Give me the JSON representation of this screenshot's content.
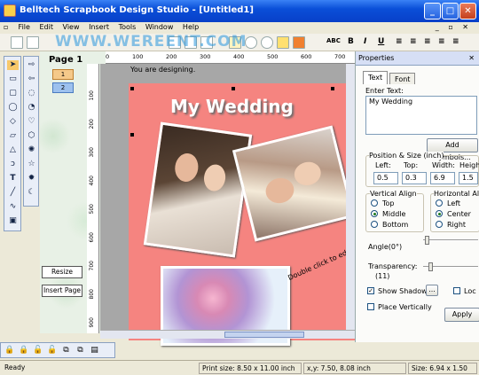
{
  "window": {
    "title": "Belltech Scrapbook Design Studio - [Untitled1]",
    "min": "_",
    "max": "□",
    "close": "✕"
  },
  "menu": {
    "items": [
      "File",
      "Edit",
      "View",
      "Insert",
      "Tools",
      "Window",
      "Help"
    ],
    "mdi_controls": "_ ▫ ✕"
  },
  "toolbar": {
    "watermark": "WWW.WEREENT.COM",
    "bold": "B",
    "italic": "I",
    "underline": "U",
    "abc": "ABC"
  },
  "pages_panel": {
    "label": "Page 1",
    "pages": [
      "1",
      "2"
    ],
    "resize_label": "Resize",
    "insert_page_label": "Insert Page"
  },
  "ruler": {
    "top_ticks": [
      "0",
      "100",
      "200",
      "300",
      "400",
      "500",
      "600",
      "700"
    ],
    "left_ticks": [
      "100",
      "200",
      "300",
      "400",
      "500",
      "600",
      "700",
      "800",
      "900"
    ]
  },
  "canvas": {
    "note": "You are designing.",
    "title_text": "My Wedding",
    "hint": "Double click to edit text"
  },
  "properties": {
    "header": "Properties",
    "tabs": [
      "Text",
      "Font"
    ],
    "enter_text_label": "Enter Text:",
    "text_value": "My Wedding",
    "add_symbols": "Add Symbols...",
    "pos_size_label": "Position & Size (inch)",
    "left_label": "Left:",
    "top_label": "Top:",
    "width_label": "Width:",
    "height_label": "Heigh",
    "left_value": "0.5",
    "top_value": "0.3",
    "width_value": "6.9",
    "height_value": "1.5",
    "valign_label": "Vertical Align",
    "valign_options": [
      "Top",
      "Middle",
      "Bottom"
    ],
    "valign_selected": "Middle",
    "halign_label": "Horizontal Al",
    "halign_options": [
      "Left",
      "Center",
      "Right"
    ],
    "halign_selected": "Center",
    "angle_label": "Angle(0°)",
    "transparency_label": "Transparency:",
    "transparency_value": "(11)",
    "show_shadow": "Show Shadow",
    "ellipsis": "...",
    "lock": "Loc",
    "place_vertically": "Place Vertically",
    "apply": "Apply"
  },
  "status": {
    "ready": "Ready",
    "print_size": "Print size: 8.50 x 11.00 inch",
    "xy": "x,y: 7.50, 8.08 inch",
    "size": "Size: 6.94 x 1.50"
  },
  "colors": {
    "page_bg": "#f58480",
    "titlebar": "#0a4fd8",
    "canvas_bg": "#a7a7a7"
  },
  "icons": [
    "arrow-icon",
    "rectangle-icon",
    "ellipse-icon",
    "star-icon",
    "text-icon",
    "line-icon",
    "lock-icon",
    "zoom-in-icon",
    "zoom-out-icon"
  ]
}
